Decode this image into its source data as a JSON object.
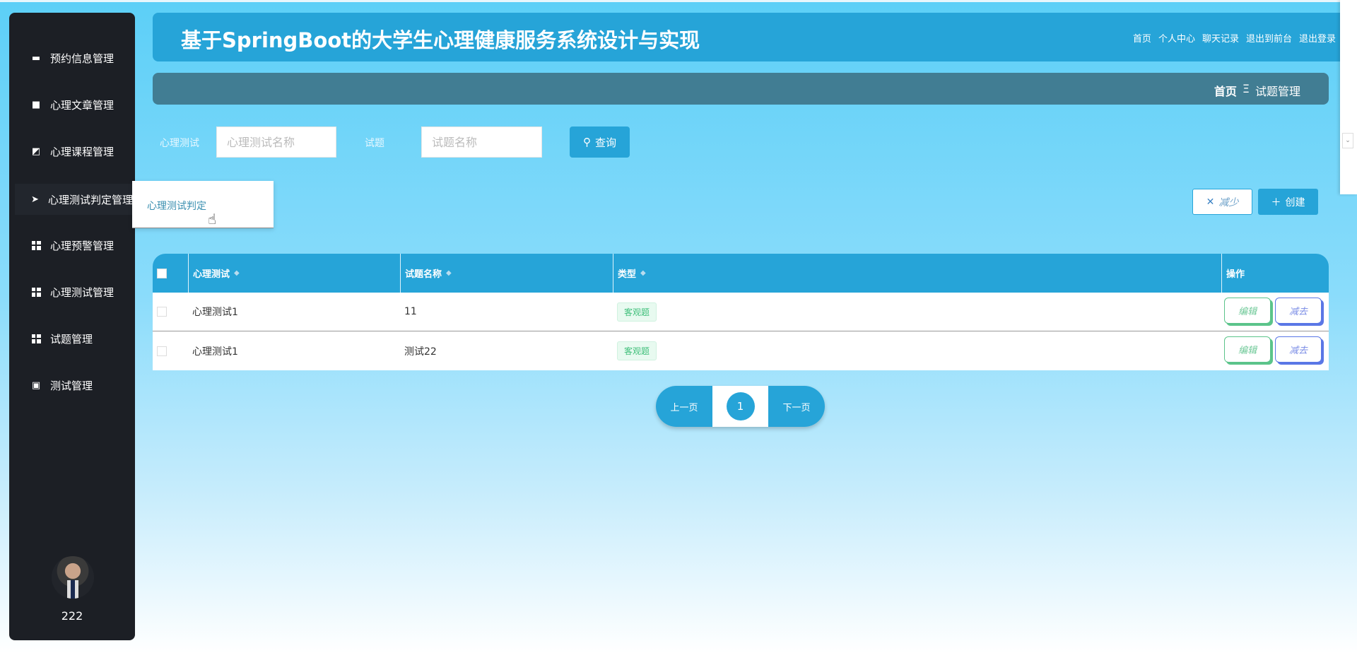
{
  "sidebar": {
    "items": [
      {
        "label": "预约信息管理",
        "icon": "comment-icon"
      },
      {
        "label": "心理文章管理",
        "icon": "wallet-icon"
      },
      {
        "label": "心理课程管理",
        "icon": "chart-icon"
      },
      {
        "label": "心理测试判定管理",
        "icon": "paper-plane-icon"
      },
      {
        "label": "心理预警管理",
        "icon": "grid-icon"
      },
      {
        "label": "心理测试管理",
        "icon": "grid-icon"
      },
      {
        "label": "试题管理",
        "icon": "grid-icon"
      },
      {
        "label": "测试管理",
        "icon": "clipboard-icon"
      }
    ],
    "username": "222"
  },
  "dropdown": {
    "item": "心理测试判定"
  },
  "header": {
    "title": "基于SpringBoot的大学生心理健康服务系统设计与实现",
    "links": [
      "首页",
      "个人中心",
      "聊天记录",
      "退出到前台",
      "退出登录"
    ]
  },
  "breadcrumb": {
    "home": "首页",
    "separator": "Ξ",
    "current": "试题管理"
  },
  "search": {
    "test_label": "心理测试",
    "test_placeholder": "心理测试名称",
    "question_label": "试题",
    "question_placeholder": "试题名称",
    "button": "查询"
  },
  "actions": {
    "delete": "减少",
    "create": "创建"
  },
  "table": {
    "columns": [
      "心理测试",
      "试题名称",
      "类型",
      "操作"
    ],
    "rows": [
      {
        "test": "心理测试1",
        "question": "11",
        "type": "客观题",
        "edit": "编辑",
        "remove": "减去"
      },
      {
        "test": "心理测试1",
        "question": "测试22",
        "type": "客观题",
        "edit": "编辑",
        "remove": "减去"
      }
    ]
  },
  "pagination": {
    "prev": "上一页",
    "current": "1",
    "next": "下一页"
  },
  "colors": {
    "primary": "#26a4d8",
    "sidebar": "#1c1f25",
    "breadcrumb": "#417d93"
  }
}
